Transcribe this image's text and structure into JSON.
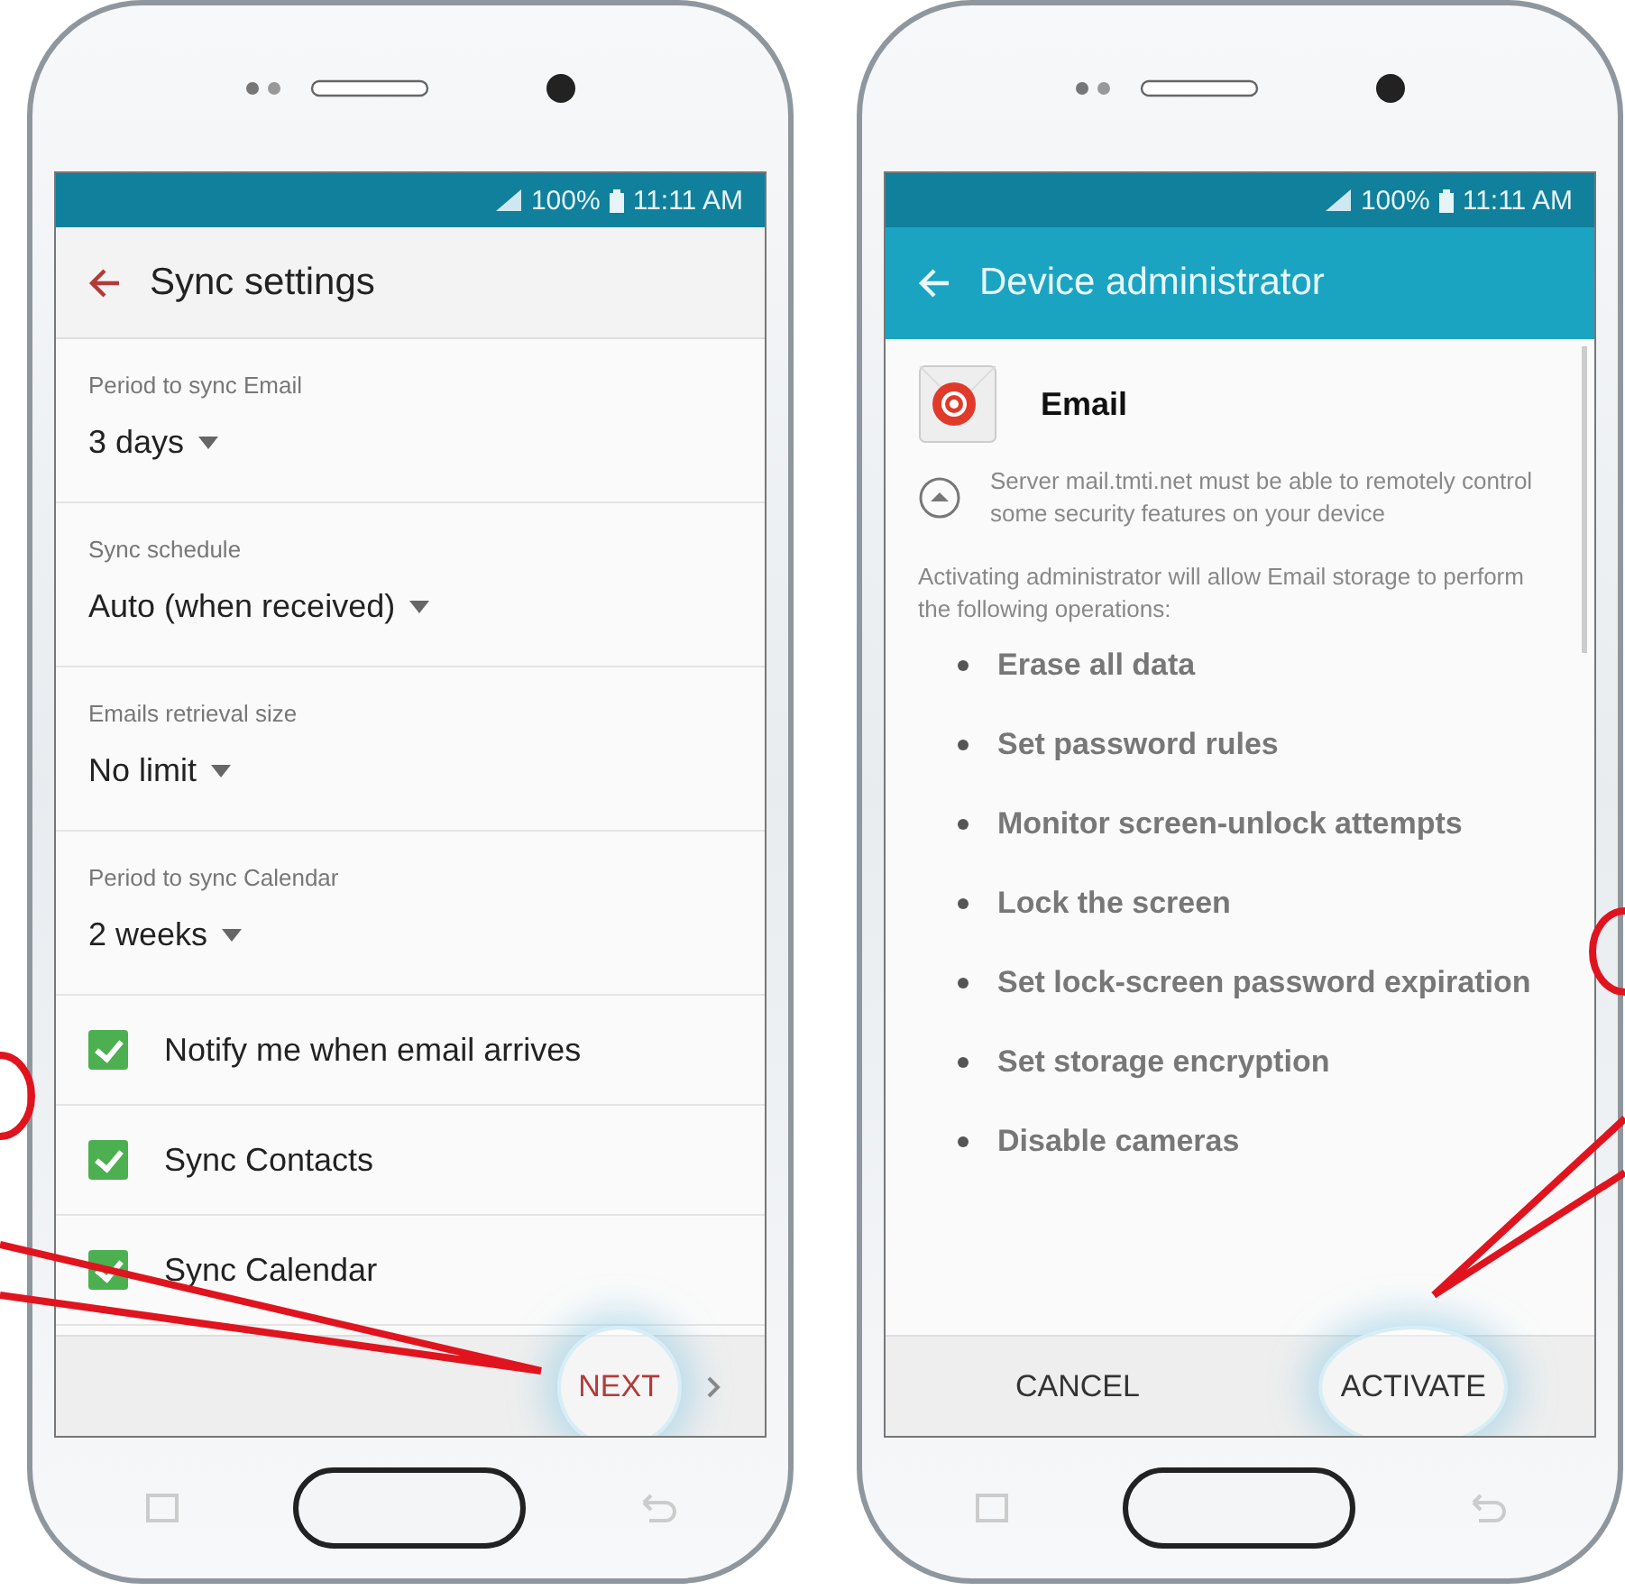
{
  "sync_phone": {
    "status_bar": {
      "battery": "100%",
      "time": "11:11 AM"
    },
    "app_bar": {
      "title": "Sync settings"
    },
    "settings": [
      {
        "kind": "dropdown",
        "label": "Period to sync Email",
        "value": "3 days"
      },
      {
        "kind": "dropdown",
        "label": "Sync schedule",
        "value": "Auto (when received)"
      },
      {
        "kind": "dropdown",
        "label": "Emails retrieval size",
        "value": "No limit"
      },
      {
        "kind": "dropdown",
        "label": "Period to sync Calendar",
        "value": "2 weeks"
      },
      {
        "kind": "checkbox",
        "label": "Notify me when email arrives",
        "checked": true
      },
      {
        "kind": "checkbox",
        "label": "Sync Contacts",
        "checked": true
      },
      {
        "kind": "checkbox",
        "label": "Sync Calendar",
        "checked": true
      }
    ],
    "bottom_bar": {
      "next": {
        "label": "NEXT",
        "highlighted": true
      }
    }
  },
  "admin_phone": {
    "status_bar": {
      "battery": "100%",
      "time": "11:11 AM"
    },
    "app_bar": {
      "title": "Device administrator"
    },
    "app": {
      "name": "Email"
    },
    "notice": "Server mail.tmti.net must be able to remotely control some security features on your device",
    "intro": "Activating administrator will allow Email storage to perform the following operations:",
    "operations": [
      "Erase all data",
      "Set password rules",
      "Monitor screen-unlock attempts",
      "Lock the screen",
      "Set lock-screen password expiration",
      "Set storage encryption",
      "Disable cameras"
    ],
    "bottom_bar": {
      "buttons": [
        {
          "label": "CANCEL",
          "highlighted": false
        },
        {
          "label": "ACTIVATE",
          "highlighted": true
        }
      ]
    }
  }
}
